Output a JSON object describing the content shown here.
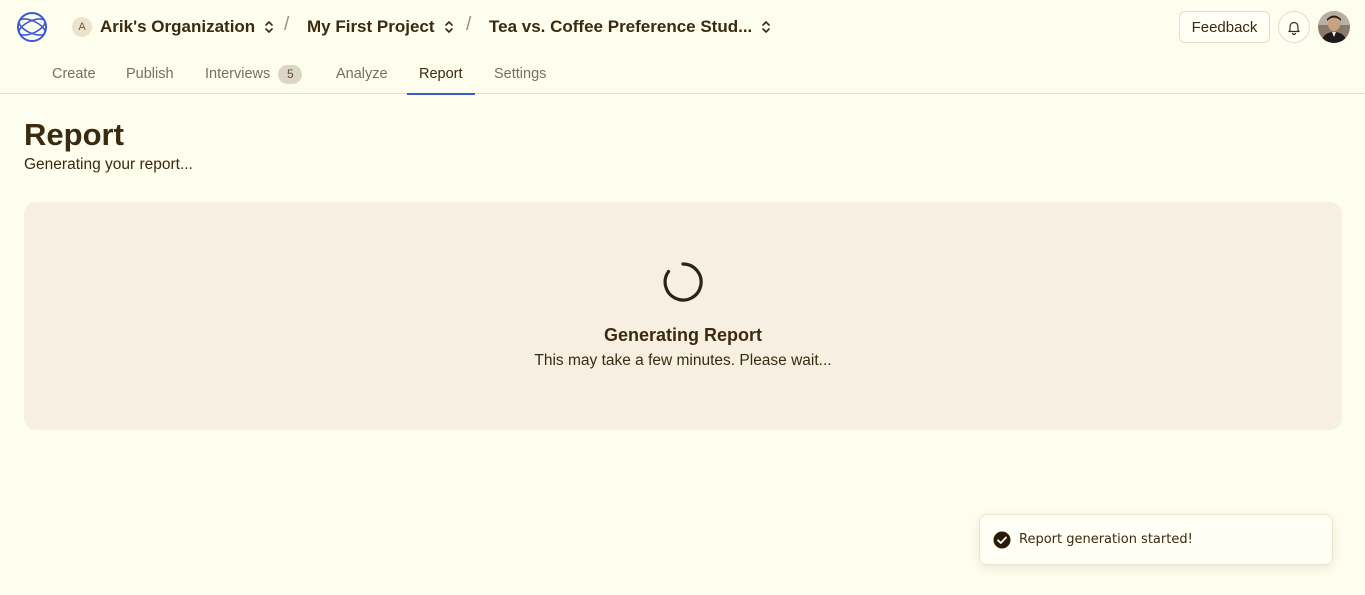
{
  "header": {
    "org": {
      "initial": "A",
      "name": "Arik's Organization"
    },
    "project": "My First Project",
    "study": "Tea vs. Coffee Preference Stud...",
    "separator": "/",
    "feedback_label": "Feedback",
    "icons": [
      "logo-icon",
      "chevrons-up-down-icon",
      "bell-icon",
      "user-avatar"
    ]
  },
  "tabs": [
    {
      "label": "Create"
    },
    {
      "label": "Publish"
    },
    {
      "label": "Interviews",
      "badge": "5"
    },
    {
      "label": "Analyze"
    },
    {
      "label": "Report",
      "active": true
    },
    {
      "label": "Settings"
    }
  ],
  "page": {
    "title": "Report",
    "subtitle": "Generating your report..."
  },
  "loading_card": {
    "title": "Generating Report",
    "message": "This may take a few minutes. Please wait..."
  },
  "toast": {
    "message": "Report generation started!"
  },
  "colors": {
    "background": "#fefeee",
    "text": "#3a2a10",
    "accent": "#3b5bd6",
    "card": "#f7f0e2"
  }
}
